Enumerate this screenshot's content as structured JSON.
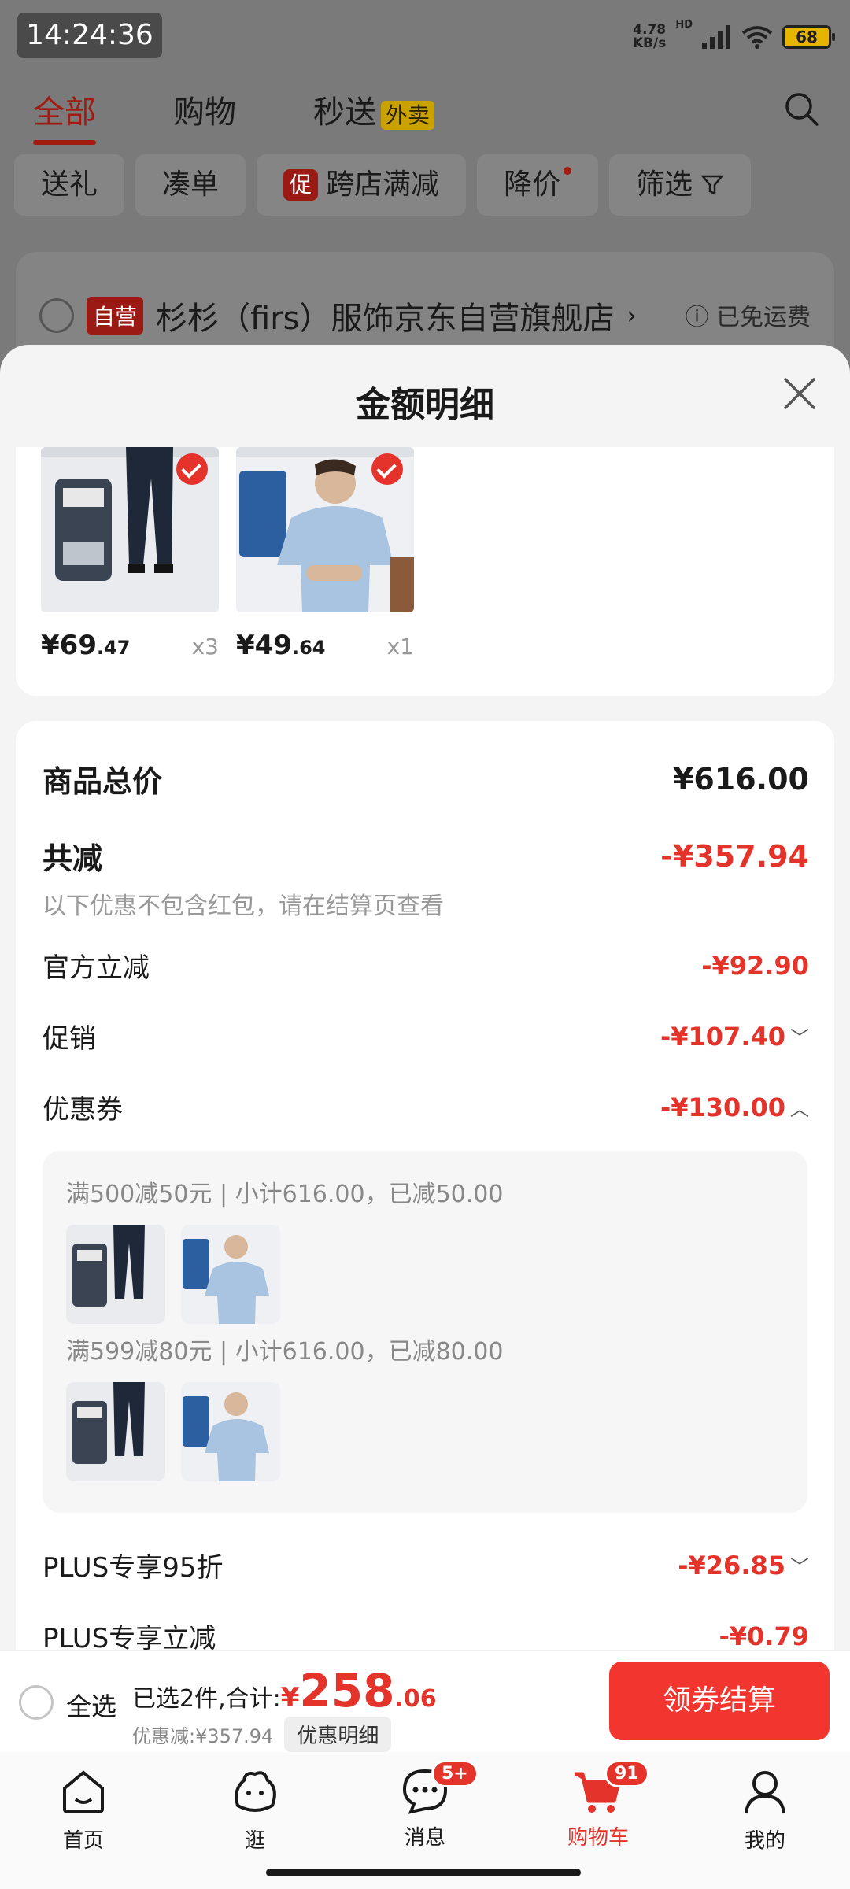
{
  "status_bar": {
    "time": "14:24:36",
    "net_speed": "4.78",
    "net_unit": "KB/s",
    "hd": "HD",
    "battery": "68"
  },
  "header": {
    "tabs": [
      "全部",
      "购物",
      "秒送"
    ],
    "waimai_badge": "外卖"
  },
  "filters": {
    "gift": "送礼",
    "bundle": "凑单",
    "promo_tag": "促",
    "cross_store": "跨店满减",
    "price_drop": "降价",
    "filter": "筛选"
  },
  "store": {
    "tag": "自营",
    "name": "杉杉（firs）服饰京东自营旗舰店",
    "shipping": "已免运费"
  },
  "sheet": {
    "title": "金额明细",
    "products": [
      {
        "price_int": "¥69",
        "price_dec": ".47",
        "qty": "x3"
      },
      {
        "price_int": "¥49",
        "price_dec": ".64",
        "qty": "x1"
      }
    ],
    "total_label": "商品总价",
    "total_value": "¥616.00",
    "discount_label": "共减",
    "discount_value": "-¥357.94",
    "discount_note": "以下优惠不包含红包，请在结算页查看",
    "official_label": "官方立减",
    "official_value": "-¥92.90",
    "promo_label": "促销",
    "promo_value": "-¥107.40",
    "coupon_label": "优惠券",
    "coupon_value": "-¥130.00",
    "coupons": [
      {
        "title": "满500减50元 | 小计616.00，已减50.00"
      },
      {
        "title": "满599减80元 | 小计616.00，已减80.00"
      }
    ],
    "plus95_label": "PLUS专享95折",
    "plus95_value": "-¥26.85",
    "plusdirect_label": "PLUS专享立减",
    "plusdirect_value": "-¥0.79"
  },
  "checkout": {
    "select_all": "全选",
    "selected_text": "已选2件,合计:",
    "yen": "¥",
    "total_int": "258",
    "total_dec": ".06",
    "saved": "优惠减:¥357.94",
    "detail_btn": "优惠明细",
    "submit": "领券结算"
  },
  "nav": {
    "home": "首页",
    "browse": "逛",
    "messages": "消息",
    "messages_badge": "5+",
    "cart": "购物车",
    "cart_badge": "91",
    "me": "我的"
  },
  "colors": {
    "accent": "#e4332a",
    "dim": "#7a7a7a"
  }
}
